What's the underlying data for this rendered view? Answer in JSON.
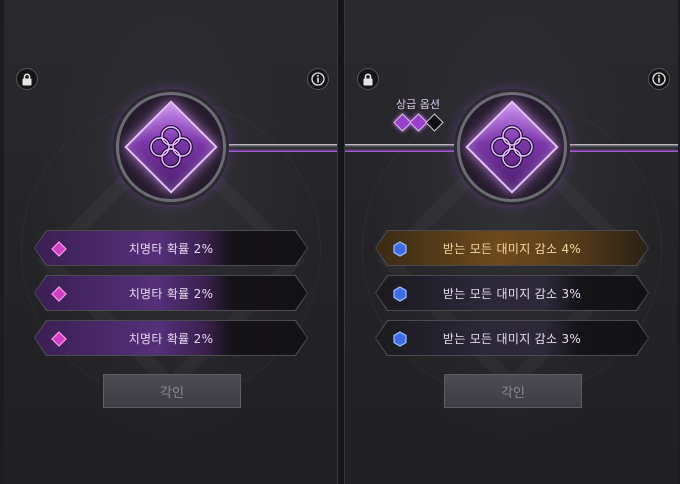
{
  "left_panel": {
    "options": [
      {
        "text": "치명타 확률 2%",
        "style": "purple"
      },
      {
        "text": "치명타 확률 2%",
        "style": "purple"
      },
      {
        "text": "치명타 확률 2%",
        "style": "purple"
      }
    ],
    "engrave_button": "각인",
    "icons": {
      "lock": "lock-icon",
      "info": "info-icon",
      "option": "pink-diamond-icon"
    }
  },
  "right_panel": {
    "superior_label": "상급 옵션",
    "superior_level": 2,
    "superior_max": 3,
    "options": [
      {
        "text": "받는 모든 대미지 감소 4%",
        "style": "gold"
      },
      {
        "text": "받는 모든 대미지 감소 3%",
        "style": "blue"
      },
      {
        "text": "받는 모든 대미지 감소 3%",
        "style": "blue"
      }
    ],
    "engrave_button": "각인",
    "icons": {
      "lock": "lock-icon",
      "info": "info-icon",
      "option": "blue-hexagon-icon"
    }
  },
  "colors": {
    "gem_purple": "#7b36a8",
    "superior_pip_on": "#9a3fd0",
    "option_pink_icon": "#e04ad4",
    "option_blue_icon": "#3e6ff0",
    "gold_text": "#f5d9a6"
  }
}
